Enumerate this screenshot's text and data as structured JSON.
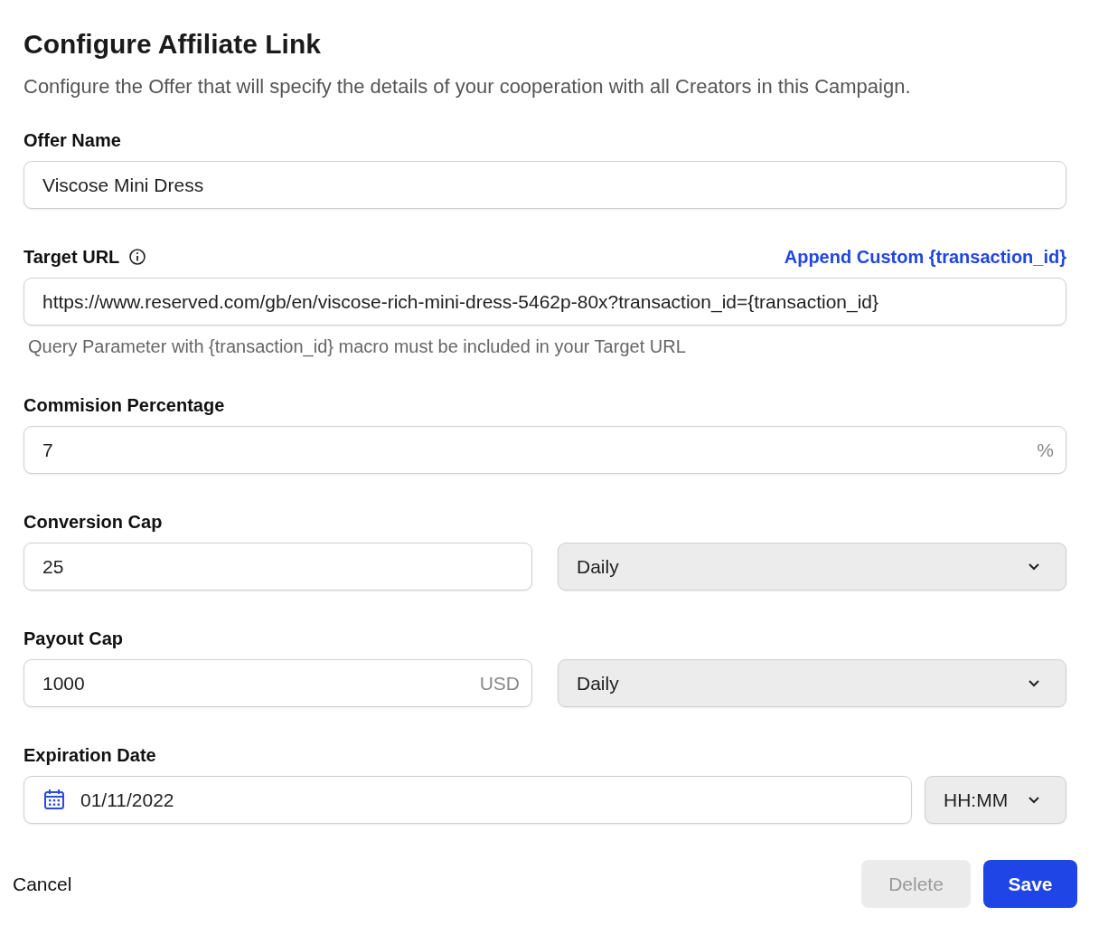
{
  "dialog": {
    "title": "Configure Affiliate Link",
    "subtitle": "Configure the Offer that will specify the details of your cooperation with all Creators in this Campaign."
  },
  "fields": [
    {
      "kind": "text",
      "label": "Offer Name",
      "value": "Viscose Mini Dress"
    },
    {
      "kind": "url",
      "label": "Target URL",
      "link": "Append Custom {transaction_id}",
      "value": "https://www.reserved.com/gb/en/viscose-rich-mini-dress-5462p-80x?transaction_id={transaction_id}",
      "hint": "Query Parameter with {transaction_id} macro must be included in your Target URL"
    },
    {
      "kind": "suffix",
      "label": "Commision Percentage",
      "value": "7",
      "suffix": "%"
    },
    {
      "kind": "split",
      "label": "Conversion Cap",
      "value": "25",
      "select": "Daily"
    },
    {
      "kind": "split",
      "label": "Payout Cap",
      "value": "1000",
      "suffix": "USD",
      "select": "Daily"
    },
    {
      "kind": "date",
      "label": "Expiration Date",
      "value": "01/11/2022",
      "select": "HH:MM"
    }
  ],
  "buttons": [
    {
      "kind": "cancel",
      "label": "Cancel",
      "disabled": false
    },
    {
      "kind": "secondary",
      "label": "Delete",
      "disabled": true
    },
    {
      "kind": "primary",
      "label": "Save",
      "disabled": false
    }
  ]
}
